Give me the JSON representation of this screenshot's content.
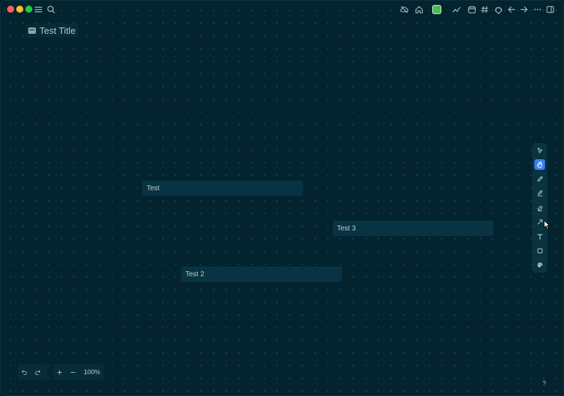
{
  "window": {
    "title_icons": [
      "menu-icon",
      "search-icon"
    ],
    "right_icons": [
      "cloud-off-icon",
      "home-icon",
      "color-swatch-icon",
      "graph-icon",
      "calendar-icon",
      "tag-icon",
      "puzzle-icon",
      "back-arrow-icon",
      "forward-arrow-icon",
      "more-icon",
      "sidebar-toggle-icon"
    ],
    "swatch_color": "#4cbb5b"
  },
  "page": {
    "title": "Test Title"
  },
  "canvas": {
    "nodes": [
      {
        "label": "Test"
      },
      {
        "label": "Test 3"
      },
      {
        "label": "Test 2"
      }
    ]
  },
  "toolbar": {
    "tools": [
      "select-tool",
      "hand-tool",
      "pencil-tool",
      "highlighter-tool",
      "eraser-tool",
      "connector-tool",
      "text-tool",
      "rectangle-tool",
      "color-palette-tool"
    ],
    "active_tool": "hand-tool",
    "accent": "#3b7ff5"
  },
  "bottom": {
    "zoom": "100%",
    "help": "?"
  }
}
